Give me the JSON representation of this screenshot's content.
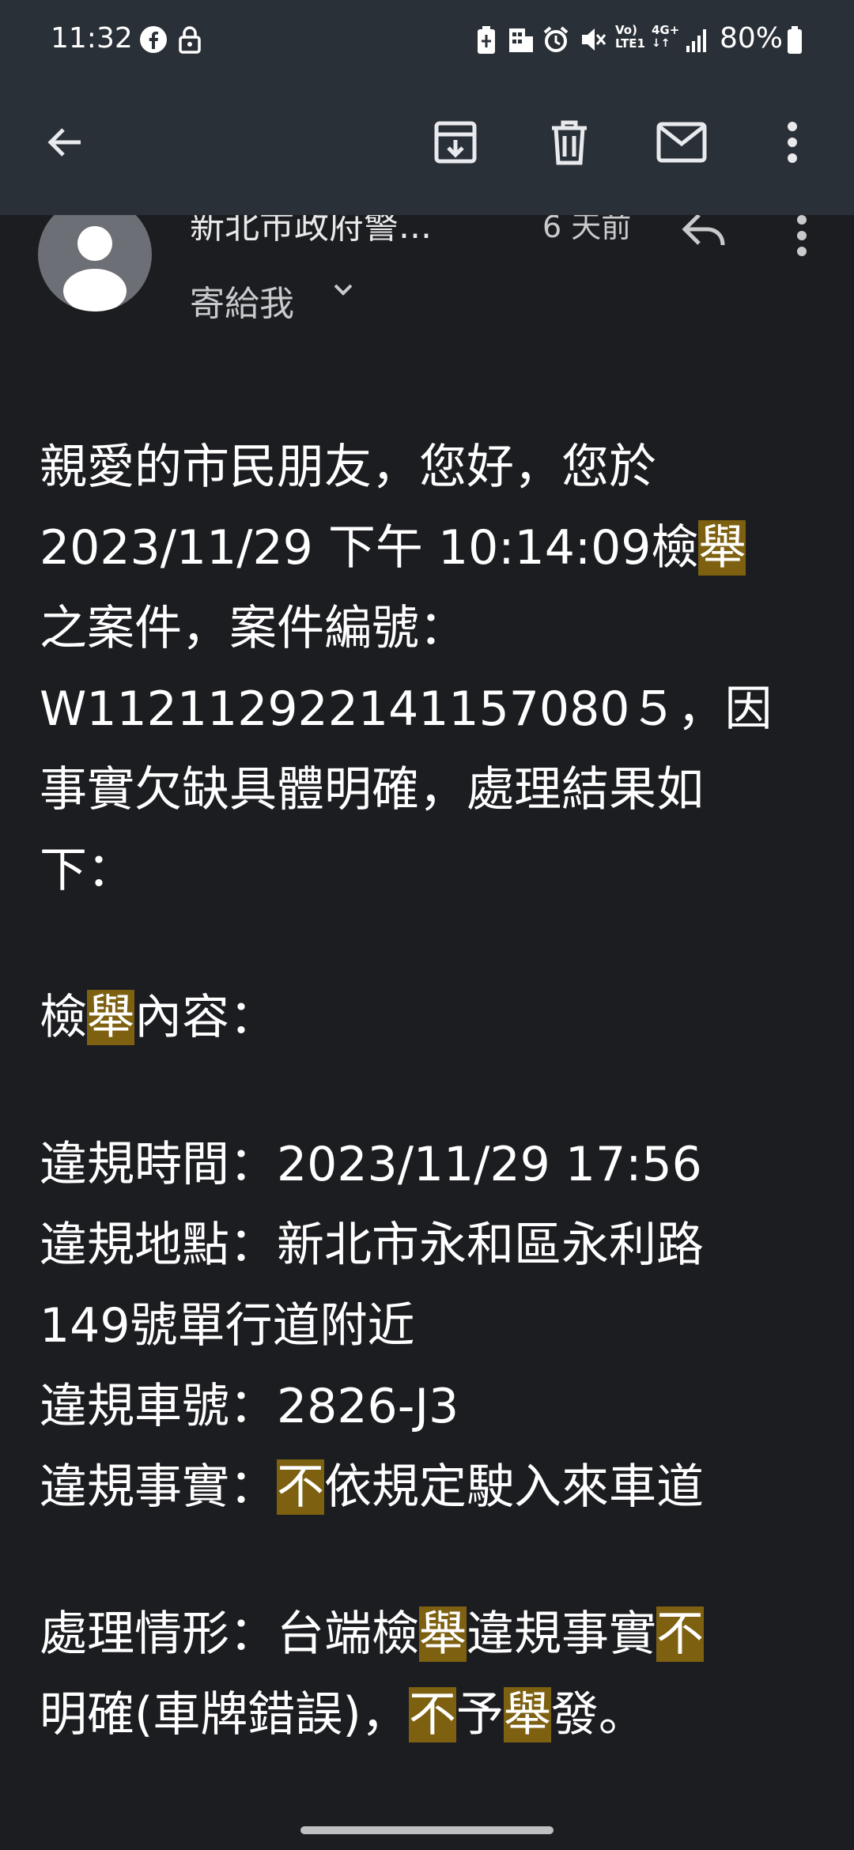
{
  "status_bar": {
    "time": "11:32",
    "battery": "80%",
    "icons": [
      "facebook-icon",
      "lock-icon",
      "battery-saver-icon",
      "hotel-icon",
      "alarm-icon",
      "mute-icon",
      "volte-icon",
      "4g-icon",
      "signal-icon",
      "battery-icon"
    ],
    "volte_label_top": "Vo)",
    "volte_label_bottom": "LTE1",
    "net_label": "4G+"
  },
  "app_bar": {
    "icons": [
      "back-arrow-icon",
      "archive-icon",
      "delete-icon",
      "mail-icon",
      "more-vert-icon"
    ]
  },
  "email": {
    "sender": "新北市政府警...",
    "time_ago": "6 天前",
    "recipient": "寄給我"
  },
  "body": {
    "l1": "親愛的市民朋友，您好，您於",
    "l2_a": "2023/11/29 下午 10:14:09檢",
    "l2_hl": "舉",
    "l3": "之案件，案件編號：",
    "l4": "W112112922141157080５，因",
    "l5": "事實欠缺具體明確，處理結果如",
    "l6": "下：",
    "l7_a": "檢",
    "l7_hl": "舉",
    "l7_b": "內容：",
    "l8": "違規時間：2023/11/29 17:56",
    "l9": "違規地點：新北市永和區永利路",
    "l10": "149號單行道附近",
    "l11": "違規車號：2826-J3",
    "l12_a": "違規事實：",
    "l12_hl": "不",
    "l12_b": "依規定駛入來車道",
    "l13_a": "處理情形：台端檢",
    "l13_hl1": "舉",
    "l13_b": "違規事實",
    "l13_hl2": "不",
    "l14_a": "明確(車牌錯誤)，",
    "l14_hl1": "不",
    "l14_b": "予",
    "l14_hl2": "舉",
    "l14_c": "發。"
  },
  "colors": {
    "background": "#1c1d21",
    "top_bar": "#2a3037",
    "highlight": "#7d6010"
  }
}
